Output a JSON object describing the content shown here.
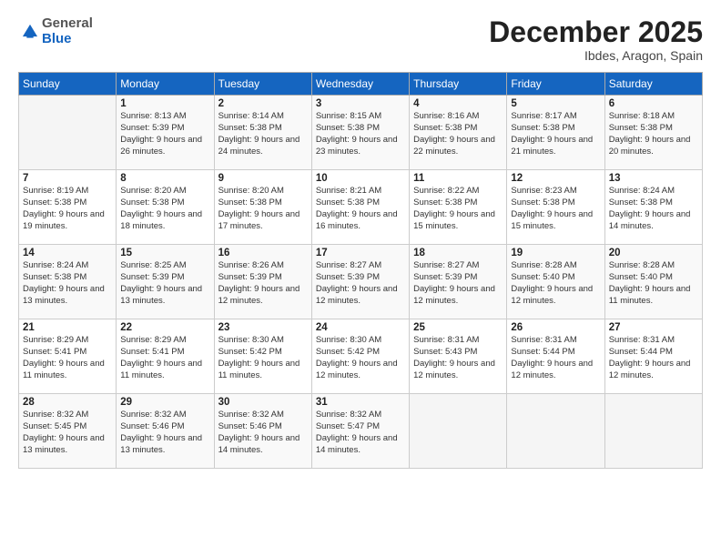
{
  "logo": {
    "general": "General",
    "blue": "Blue"
  },
  "header": {
    "title": "December 2025",
    "location": "Ibdes, Aragon, Spain"
  },
  "weekdays": [
    "Sunday",
    "Monday",
    "Tuesday",
    "Wednesday",
    "Thursday",
    "Friday",
    "Saturday"
  ],
  "weeks": [
    [
      {
        "day": "",
        "sunrise": "",
        "sunset": "",
        "daylight": ""
      },
      {
        "day": "1",
        "sunrise": "Sunrise: 8:13 AM",
        "sunset": "Sunset: 5:39 PM",
        "daylight": "Daylight: 9 hours and 26 minutes."
      },
      {
        "day": "2",
        "sunrise": "Sunrise: 8:14 AM",
        "sunset": "Sunset: 5:38 PM",
        "daylight": "Daylight: 9 hours and 24 minutes."
      },
      {
        "day": "3",
        "sunrise": "Sunrise: 8:15 AM",
        "sunset": "Sunset: 5:38 PM",
        "daylight": "Daylight: 9 hours and 23 minutes."
      },
      {
        "day": "4",
        "sunrise": "Sunrise: 8:16 AM",
        "sunset": "Sunset: 5:38 PM",
        "daylight": "Daylight: 9 hours and 22 minutes."
      },
      {
        "day": "5",
        "sunrise": "Sunrise: 8:17 AM",
        "sunset": "Sunset: 5:38 PM",
        "daylight": "Daylight: 9 hours and 21 minutes."
      },
      {
        "day": "6",
        "sunrise": "Sunrise: 8:18 AM",
        "sunset": "Sunset: 5:38 PM",
        "daylight": "Daylight: 9 hours and 20 minutes."
      }
    ],
    [
      {
        "day": "7",
        "sunrise": "Sunrise: 8:19 AM",
        "sunset": "Sunset: 5:38 PM",
        "daylight": "Daylight: 9 hours and 19 minutes."
      },
      {
        "day": "8",
        "sunrise": "Sunrise: 8:20 AM",
        "sunset": "Sunset: 5:38 PM",
        "daylight": "Daylight: 9 hours and 18 minutes."
      },
      {
        "day": "9",
        "sunrise": "Sunrise: 8:20 AM",
        "sunset": "Sunset: 5:38 PM",
        "daylight": "Daylight: 9 hours and 17 minutes."
      },
      {
        "day": "10",
        "sunrise": "Sunrise: 8:21 AM",
        "sunset": "Sunset: 5:38 PM",
        "daylight": "Daylight: 9 hours and 16 minutes."
      },
      {
        "day": "11",
        "sunrise": "Sunrise: 8:22 AM",
        "sunset": "Sunset: 5:38 PM",
        "daylight": "Daylight: 9 hours and 15 minutes."
      },
      {
        "day": "12",
        "sunrise": "Sunrise: 8:23 AM",
        "sunset": "Sunset: 5:38 PM",
        "daylight": "Daylight: 9 hours and 15 minutes."
      },
      {
        "day": "13",
        "sunrise": "Sunrise: 8:24 AM",
        "sunset": "Sunset: 5:38 PM",
        "daylight": "Daylight: 9 hours and 14 minutes."
      }
    ],
    [
      {
        "day": "14",
        "sunrise": "Sunrise: 8:24 AM",
        "sunset": "Sunset: 5:38 PM",
        "daylight": "Daylight: 9 hours and 13 minutes."
      },
      {
        "day": "15",
        "sunrise": "Sunrise: 8:25 AM",
        "sunset": "Sunset: 5:39 PM",
        "daylight": "Daylight: 9 hours and 13 minutes."
      },
      {
        "day": "16",
        "sunrise": "Sunrise: 8:26 AM",
        "sunset": "Sunset: 5:39 PM",
        "daylight": "Daylight: 9 hours and 12 minutes."
      },
      {
        "day": "17",
        "sunrise": "Sunrise: 8:27 AM",
        "sunset": "Sunset: 5:39 PM",
        "daylight": "Daylight: 9 hours and 12 minutes."
      },
      {
        "day": "18",
        "sunrise": "Sunrise: 8:27 AM",
        "sunset": "Sunset: 5:39 PM",
        "daylight": "Daylight: 9 hours and 12 minutes."
      },
      {
        "day": "19",
        "sunrise": "Sunrise: 8:28 AM",
        "sunset": "Sunset: 5:40 PM",
        "daylight": "Daylight: 9 hours and 12 minutes."
      },
      {
        "day": "20",
        "sunrise": "Sunrise: 8:28 AM",
        "sunset": "Sunset: 5:40 PM",
        "daylight": "Daylight: 9 hours and 11 minutes."
      }
    ],
    [
      {
        "day": "21",
        "sunrise": "Sunrise: 8:29 AM",
        "sunset": "Sunset: 5:41 PM",
        "daylight": "Daylight: 9 hours and 11 minutes."
      },
      {
        "day": "22",
        "sunrise": "Sunrise: 8:29 AM",
        "sunset": "Sunset: 5:41 PM",
        "daylight": "Daylight: 9 hours and 11 minutes."
      },
      {
        "day": "23",
        "sunrise": "Sunrise: 8:30 AM",
        "sunset": "Sunset: 5:42 PM",
        "daylight": "Daylight: 9 hours and 11 minutes."
      },
      {
        "day": "24",
        "sunrise": "Sunrise: 8:30 AM",
        "sunset": "Sunset: 5:42 PM",
        "daylight": "Daylight: 9 hours and 12 minutes."
      },
      {
        "day": "25",
        "sunrise": "Sunrise: 8:31 AM",
        "sunset": "Sunset: 5:43 PM",
        "daylight": "Daylight: 9 hours and 12 minutes."
      },
      {
        "day": "26",
        "sunrise": "Sunrise: 8:31 AM",
        "sunset": "Sunset: 5:44 PM",
        "daylight": "Daylight: 9 hours and 12 minutes."
      },
      {
        "day": "27",
        "sunrise": "Sunrise: 8:31 AM",
        "sunset": "Sunset: 5:44 PM",
        "daylight": "Daylight: 9 hours and 12 minutes."
      }
    ],
    [
      {
        "day": "28",
        "sunrise": "Sunrise: 8:32 AM",
        "sunset": "Sunset: 5:45 PM",
        "daylight": "Daylight: 9 hours and 13 minutes."
      },
      {
        "day": "29",
        "sunrise": "Sunrise: 8:32 AM",
        "sunset": "Sunset: 5:46 PM",
        "daylight": "Daylight: 9 hours and 13 minutes."
      },
      {
        "day": "30",
        "sunrise": "Sunrise: 8:32 AM",
        "sunset": "Sunset: 5:46 PM",
        "daylight": "Daylight: 9 hours and 14 minutes."
      },
      {
        "day": "31",
        "sunrise": "Sunrise: 8:32 AM",
        "sunset": "Sunset: 5:47 PM",
        "daylight": "Daylight: 9 hours and 14 minutes."
      },
      {
        "day": "",
        "sunrise": "",
        "sunset": "",
        "daylight": ""
      },
      {
        "day": "",
        "sunrise": "",
        "sunset": "",
        "daylight": ""
      },
      {
        "day": "",
        "sunrise": "",
        "sunset": "",
        "daylight": ""
      }
    ]
  ]
}
